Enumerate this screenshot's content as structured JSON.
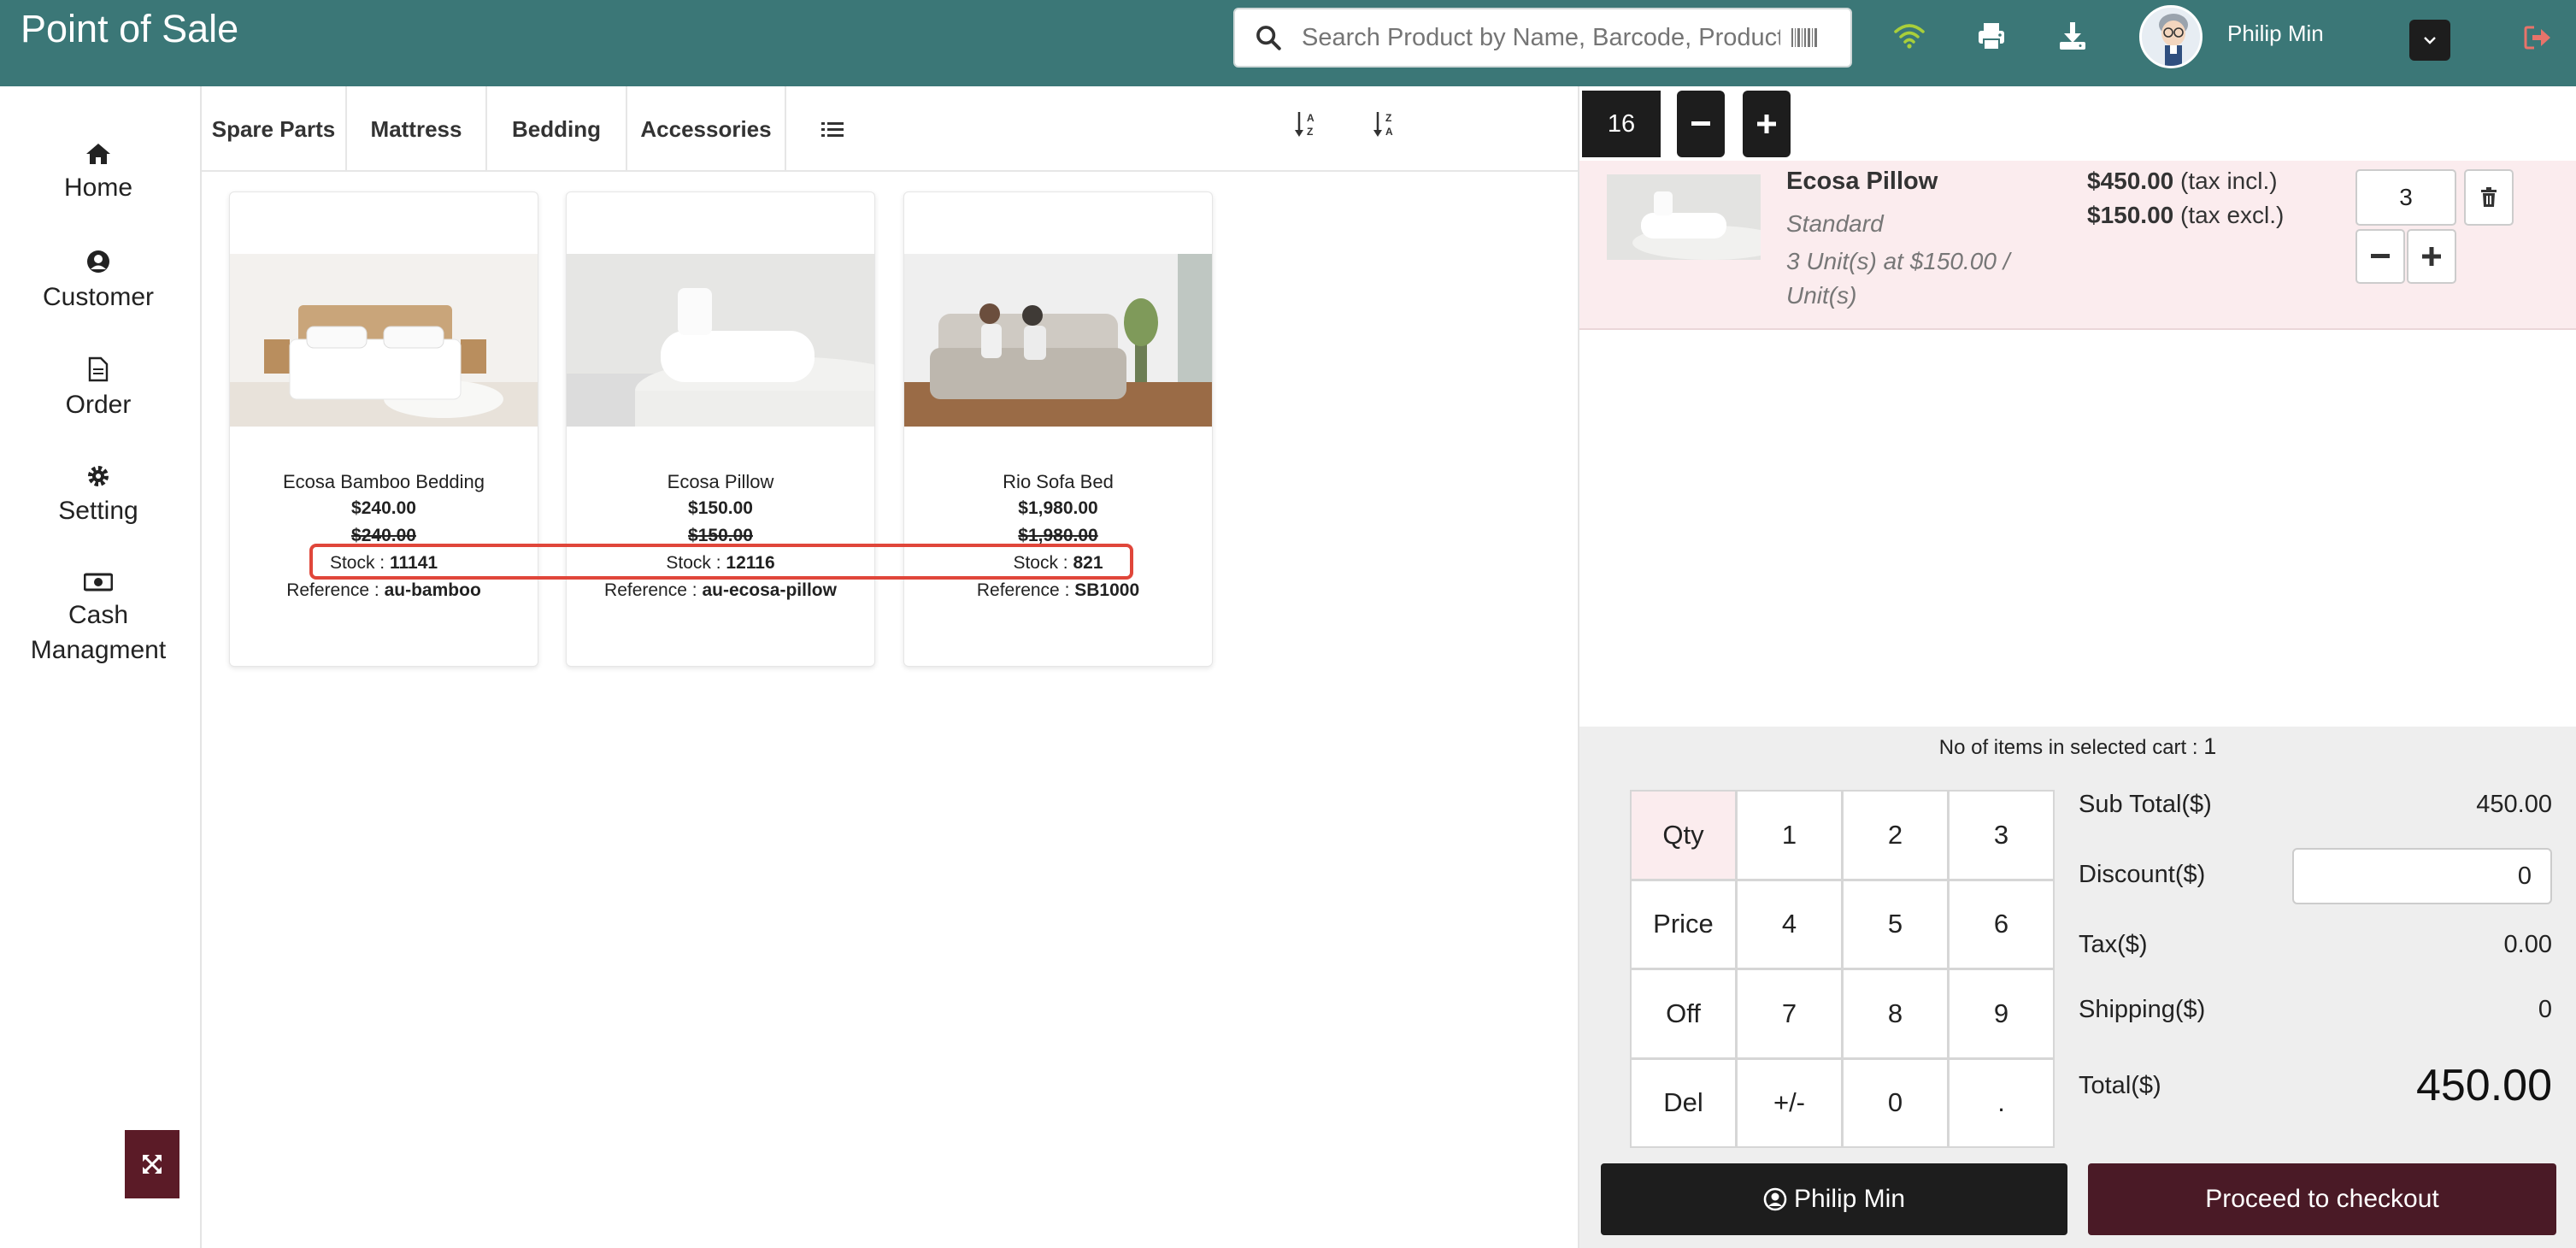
{
  "header": {
    "title": "Point of Sale",
    "search_placeholder": "Search Product by Name, Barcode, Product I",
    "user_name": "Philip Min",
    "icons": [
      "search-icon",
      "barcode-icon",
      "wifi-icon",
      "print-icon",
      "download-icon",
      "chevron-down-icon",
      "logout-icon"
    ]
  },
  "sidebar": {
    "items": [
      {
        "label": "Home",
        "icon": "home-icon"
      },
      {
        "label": "Customer",
        "icon": "user-circle-icon"
      },
      {
        "label": "Order",
        "icon": "document-icon"
      },
      {
        "label": "Setting",
        "icon": "gear-icon"
      },
      {
        "label": "Cash Managment",
        "icon": "money-icon"
      }
    ]
  },
  "categories": [
    "Spare Parts",
    "Mattress",
    "Bedding",
    "Accessories"
  ],
  "products": [
    {
      "name": "Ecosa Bamboo Bedding",
      "price": "$240.00",
      "old_price": "$240.00",
      "stock_label": "Stock : ",
      "stock": "11141",
      "ref_label": "Reference : ",
      "ref": "au-bamboo"
    },
    {
      "name": "Ecosa Pillow",
      "price": "$150.00",
      "old_price": "$150.00",
      "stock_label": "Stock : ",
      "stock": "12116",
      "ref_label": "Reference : ",
      "ref": "au-ecosa-pillow"
    },
    {
      "name": "Rio Sofa Bed",
      "price": "$1,980.00",
      "old_price": "$1,980.00",
      "stock_label": "Stock : ",
      "stock": "821",
      "ref_label": "Reference : ",
      "ref": "SB1000"
    }
  ],
  "cart": {
    "number": "16",
    "line": {
      "name": "Ecosa Pillow",
      "variant": "Standard",
      "detail": "3 Unit(s) at $150.00 / Unit(s)",
      "price_incl": "$450.00",
      "price_incl_suffix": " (tax incl.)",
      "price_excl": "$150.00",
      "price_excl_suffix": " (tax excl.)",
      "qty": "3"
    },
    "items_count_label": "No of items in selected cart : ",
    "items_count": "1"
  },
  "keypad": [
    "Qty",
    "1",
    "2",
    "3",
    "Price",
    "4",
    "5",
    "6",
    "Off",
    "7",
    "8",
    "9",
    "Del",
    "+/-",
    "0",
    "."
  ],
  "summary": {
    "subtotal_label": "Sub Total($)",
    "subtotal": "450.00",
    "discount_label": "Discount($)",
    "discount": "0",
    "tax_label": "Tax($)",
    "tax": "0.00",
    "shipping_label": "Shipping($)",
    "shipping": "0",
    "total_label": "Total($)",
    "total": "450.00"
  },
  "buttons": {
    "customer": "Philip Min",
    "checkout": "Proceed to checkout"
  }
}
